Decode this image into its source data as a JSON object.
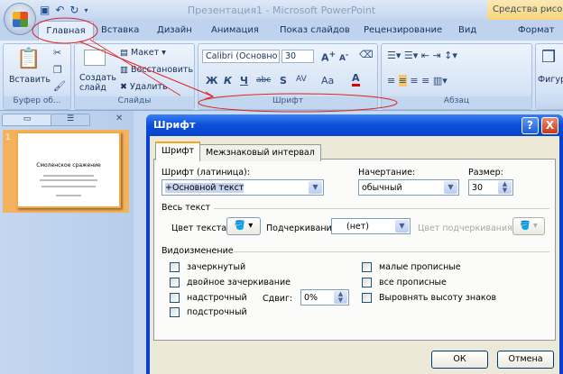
{
  "window": {
    "title": "Презентация1 - Microsoft PowerPoint",
    "context_title": "Средства рисова"
  },
  "ribbon_tabs": [
    "Главная",
    "Вставка",
    "Дизайн",
    "Анимация",
    "Показ слайдов",
    "Рецензирование",
    "Вид",
    "Формат"
  ],
  "ribbon": {
    "clipboard": {
      "label": "Буфер об...",
      "paste": "Вставить"
    },
    "slides": {
      "label": "Слайды",
      "new_slide": "Создать слайд",
      "layout": "Макет",
      "reset": "Восстановить",
      "delete": "Удалить"
    },
    "font": {
      "label": "Шрифт",
      "font_name": "Calibri (Основно",
      "font_size": "30",
      "bold": "Ж",
      "italic": "К",
      "underline": "Ч",
      "strike": "abc",
      "shadow": "S",
      "spacing": "AV",
      "case": "Aa",
      "color": "A"
    },
    "paragraph": {
      "label": "Абзац"
    },
    "drawing": {
      "shapes": "Фигуры"
    }
  },
  "slide_panel": {
    "slide_number": "1",
    "slide_title": "Смоленское сражение"
  },
  "dialog": {
    "title": "Шрифт",
    "help": "?",
    "close": "X",
    "tabs": [
      "Шрифт",
      "Межзнаковый интервал"
    ],
    "font_latin_label": "Шрифт (латиница):",
    "font_latin_value": "+Основной текст",
    "style_label": "Начертание:",
    "style_value": "обычный",
    "size_label": "Размер:",
    "size_value": "30",
    "all_text_label": "Весь текст",
    "text_color_label": "Цвет текста",
    "underline_label": "Подчеркивание",
    "underline_value": "(нет)",
    "underline_color_label": "Цвет подчеркивания",
    "effects_label": "Видоизменение",
    "effects_left": [
      "зачеркнутый",
      "двойное зачеркивание",
      "надстрочный",
      "подстрочный"
    ],
    "effects_right": [
      "малые прописные",
      "все прописные",
      "Выровнять высоту знаков"
    ],
    "offset_label": "Сдвиг:",
    "offset_value": "0%",
    "ok": "ОК",
    "cancel": "Отмена"
  }
}
